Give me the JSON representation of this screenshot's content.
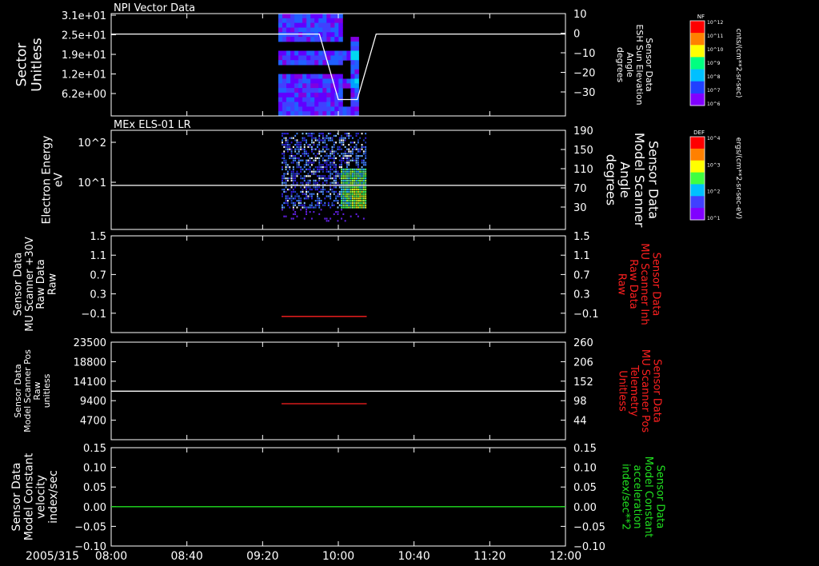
{
  "date_label": "2005/315",
  "colors": {
    "white": "#ffffff",
    "red": "#ff2020",
    "green": "#20e020",
    "background": "#000000"
  },
  "colorbars": [
    {
      "tag": "NF",
      "top_label": "10^12",
      "tick_labels": [
        "10^12",
        "10^11",
        "10^10",
        "10^9",
        "10^8",
        "10^7",
        "10^6"
      ],
      "title": "cnts/(cm**2-sr-sec)"
    },
    {
      "tag": "DEF",
      "top_label": "10^4",
      "tick_labels": [
        "10^4",
        "10^3",
        "10^2",
        "10^1"
      ],
      "title": "ergs/(cm**2-sr-sec-eV)"
    }
  ],
  "chart_data": [
    {
      "type": "heatmap",
      "title": "NPI Vector Data",
      "left_axis": {
        "label": [
          "Sector",
          "Unitless"
        ],
        "ticks": [
          "3.1e+01",
          "2.5e+01",
          "1.9e+01",
          "1.2e+01",
          "6.2e+00"
        ],
        "range": [
          0,
          31
        ]
      },
      "right_axis": {
        "label": [
          "Sensor Data",
          "ESH Sun Elevation",
          "Angle",
          "degrees"
        ],
        "ticks": [
          "10",
          "0",
          "−10",
          "−20",
          "−30"
        ],
        "range": [
          -40,
          10
        ]
      },
      "heatmap_time_range": [
        "09:30",
        "10:15"
      ],
      "line": {
        "color": "#ffffff",
        "time": [
          "08:00",
          "09:50",
          "10:00",
          "10:10",
          "10:20",
          "12:00"
        ],
        "values": [
          0,
          0,
          -32,
          -32,
          0,
          0
        ]
      }
    },
    {
      "type": "heatmap",
      "title": "MEx ELS-01 LR",
      "left_axis": {
        "label": [
          "Electron Energy",
          "eV"
        ],
        "ticks": [
          "10^2",
          "10^1"
        ],
        "scale": "log"
      },
      "right_axis": {
        "label": [
          "Sensor Data",
          "Model Scanner",
          "Angle",
          "degrees"
        ],
        "ticks": [
          "190",
          "150",
          "110",
          "70",
          "30"
        ],
        "range": [
          10,
          190
        ]
      },
      "heatmap_time_range": [
        "09:30",
        "10:15"
      ],
      "line": {
        "color": "#ffffff",
        "time": [
          "08:00",
          "12:00"
        ],
        "values": [
          90,
          90
        ]
      }
    },
    {
      "type": "line",
      "title": "",
      "left_axis": {
        "label": [
          "Sensor Data",
          "MU Scanner +30V",
          "Raw Data",
          "Raw"
        ],
        "ticks": [
          "1.5",
          "1.1",
          "0.7",
          "0.3",
          "−0.1"
        ],
        "range": [
          -0.3,
          1.5
        ]
      },
      "right_axis": {
        "label": [
          "Sensor Data",
          "MU Scanner Inh",
          "Raw Data",
          "Raw"
        ],
        "ticks": [
          "1.5",
          "1.1",
          "0.7",
          "0.3",
          "−0.1"
        ],
        "range": [
          -0.3,
          1.5
        ],
        "color": "#ff2020"
      },
      "series": [
        {
          "axis": "right",
          "color": "#ff2020",
          "time": [
            "09:30",
            "10:15"
          ],
          "values": [
            0,
            0
          ]
        }
      ]
    },
    {
      "type": "line",
      "title": "",
      "left_axis": {
        "label": [
          "Sensor Data",
          "Model Scanner Pos",
          "Raw",
          "unitless"
        ],
        "ticks": [
          "23500",
          "18800",
          "14100",
          "9400",
          "4700"
        ],
        "range": [
          0,
          23500
        ]
      },
      "right_axis": {
        "label": [
          "Sensor Data",
          "MU Scanner Pos",
          "Telemetry",
          "Unitless"
        ],
        "ticks": [
          "260",
          "206",
          "152",
          "98",
          "44"
        ],
        "range": [
          0,
          260
        ],
        "color": "#ff2020"
      },
      "series": [
        {
          "axis": "left",
          "color": "#ffffff",
          "time": [
            "08:00",
            "12:00"
          ],
          "values": [
            11700,
            11700
          ]
        },
        {
          "axis": "right",
          "color": "#ff2020",
          "time": [
            "09:30",
            "10:15"
          ],
          "values": [
            96,
            96
          ]
        }
      ]
    },
    {
      "type": "line",
      "title": "",
      "left_axis": {
        "label": [
          "Sensor Data",
          "Model Constant",
          "velocity",
          "index/sec"
        ],
        "ticks": [
          "0.15",
          "0.10",
          "0.05",
          "0.00",
          "−0.05",
          "−0.10"
        ],
        "range": [
          -0.1,
          0.15
        ]
      },
      "right_axis": {
        "label": [
          "Sensor Data",
          "Model Constant",
          "acceleration",
          "index/sec**2"
        ],
        "ticks": [
          "0.15",
          "0.10",
          "0.05",
          "0.00",
          "−0.05",
          "−0.10"
        ],
        "range": [
          -0.1,
          0.15
        ],
        "color": "#20e020"
      },
      "series": [
        {
          "axis": "right",
          "color": "#20e020",
          "time": [
            "08:00",
            "12:00"
          ],
          "values": [
            0,
            0
          ]
        }
      ]
    }
  ],
  "time_axis": {
    "ticks": [
      "08:00",
      "08:40",
      "09:20",
      "10:00",
      "10:40",
      "11:20",
      "12:00"
    ],
    "range": [
      "08:00",
      "12:00"
    ]
  }
}
